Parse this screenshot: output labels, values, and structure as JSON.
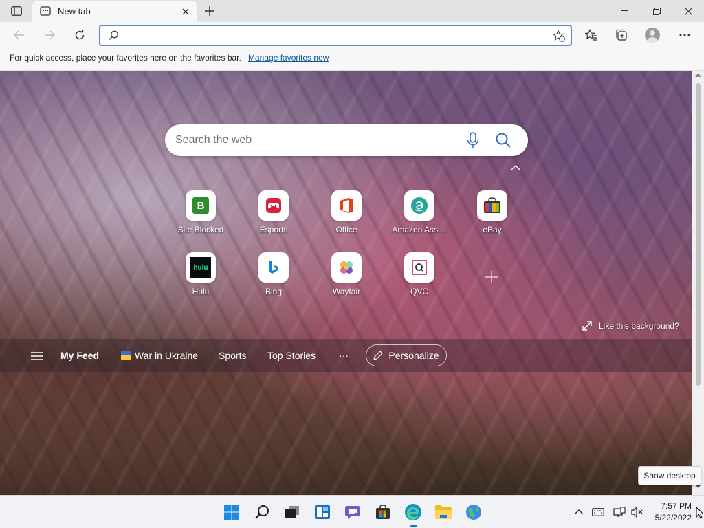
{
  "browser": {
    "tab_title": "New tab",
    "address_value": "",
    "address_placeholder": "",
    "favorites_bar": {
      "text": "For quick access, place your favorites here on the favorites bar.",
      "link": "Manage favorites now"
    }
  },
  "newtab": {
    "search_placeholder": "Search the web",
    "tiles_row1": [
      {
        "label": "Site Blocked",
        "icon": "site-blocked-icon"
      },
      {
        "label": "Esports",
        "icon": "esports-icon"
      },
      {
        "label": "Office",
        "icon": "office-icon"
      },
      {
        "label": "Amazon Assi...",
        "icon": "amazon-icon"
      },
      {
        "label": "eBay",
        "icon": "ebay-icon"
      }
    ],
    "tiles_row2": [
      {
        "label": "Hulu",
        "icon": "hulu-icon"
      },
      {
        "label": "Bing",
        "icon": "bing-icon"
      },
      {
        "label": "Wayfair",
        "icon": "wayfair-icon"
      },
      {
        "label": "QVC",
        "icon": "qvc-icon"
      }
    ],
    "hulu_logo_text": "hulu",
    "site_blocked_letter": "B",
    "like_background": "Like this background?",
    "feed": {
      "my_feed": "My Feed",
      "war_in_ukraine": "War in Ukraine",
      "sports": "Sports",
      "top_stories": "Top Stories",
      "more": "···",
      "personalize": "Personalize"
    }
  },
  "tooltip": "Show desktop",
  "taskbar": {
    "time": "7:57 PM",
    "date": "5/22/2022"
  },
  "colors": {
    "accent": "#1a73c8",
    "address_border": "#5b8cc9",
    "link": "#0b57a8"
  }
}
